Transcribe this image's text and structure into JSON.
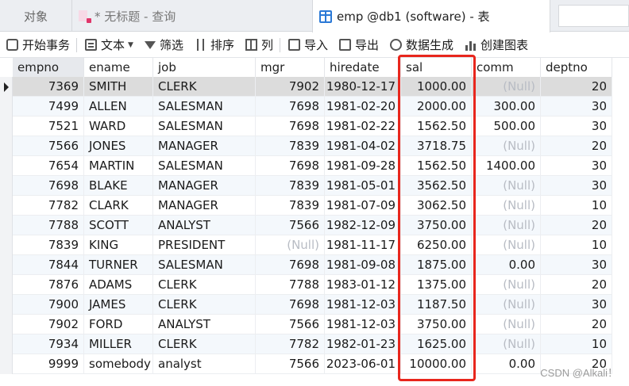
{
  "tabs": {
    "objects": "对象",
    "query": "* 无标题 - 查询",
    "table": "emp @db1 (software) - 表"
  },
  "toolbar": {
    "begin_transaction": "开始事务",
    "text": "文本",
    "filter": "筛选",
    "sort": "排序",
    "columns": "列",
    "import": "导入",
    "export": "导出",
    "data_generation": "数据生成",
    "create_chart": "创建图表"
  },
  "grid": {
    "columns": [
      "empno",
      "ename",
      "job",
      "mgr",
      "hiredate",
      "sal",
      "comm",
      "deptno"
    ],
    "rows": [
      [
        "7369",
        "SMITH",
        "CLERK",
        "7902",
        "1980-12-17",
        "1000.00",
        "(Null)",
        "20"
      ],
      [
        "7499",
        "ALLEN",
        "SALESMAN",
        "7698",
        "1981-02-20",
        "2000.00",
        "300.00",
        "30"
      ],
      [
        "7521",
        "WARD",
        "SALESMAN",
        "7698",
        "1981-02-22",
        "1562.50",
        "500.00",
        "30"
      ],
      [
        "7566",
        "JONES",
        "MANAGER",
        "7839",
        "1981-04-02",
        "3718.75",
        "(Null)",
        "20"
      ],
      [
        "7654",
        "MARTIN",
        "SALESMAN",
        "7698",
        "1981-09-28",
        "1562.50",
        "1400.00",
        "30"
      ],
      [
        "7698",
        "BLAKE",
        "MANAGER",
        "7839",
        "1981-05-01",
        "3562.50",
        "(Null)",
        "30"
      ],
      [
        "7782",
        "CLARK",
        "MANAGER",
        "7839",
        "1981-07-09",
        "3062.50",
        "(Null)",
        "10"
      ],
      [
        "7788",
        "SCOTT",
        "ANALYST",
        "7566",
        "1982-12-09",
        "3750.00",
        "(Null)",
        "20"
      ],
      [
        "7839",
        "KING",
        "PRESIDENT",
        "(Null)",
        "1981-11-17",
        "6250.00",
        "(Null)",
        "10"
      ],
      [
        "7844",
        "TURNER",
        "SALESMAN",
        "7698",
        "1981-09-08",
        "1875.00",
        "0.00",
        "30"
      ],
      [
        "7876",
        "ADAMS",
        "CLERK",
        "7788",
        "1983-01-12",
        "1375.00",
        "(Null)",
        "20"
      ],
      [
        "7900",
        "JAMES",
        "CLERK",
        "7698",
        "1981-12-03",
        "1187.50",
        "(Null)",
        "30"
      ],
      [
        "7902",
        "FORD",
        "ANALYST",
        "7566",
        "1981-12-03",
        "3750.00",
        "(Null)",
        "20"
      ],
      [
        "7934",
        "MILLER",
        "CLERK",
        "7782",
        "1982-01-23",
        "1625.00",
        "(Null)",
        "10"
      ],
      [
        "9999",
        "somebody",
        "analyst",
        "7566",
        "2023-06-01",
        "10000.00",
        "0.00",
        "20"
      ]
    ],
    "selected_row": 0
  },
  "watermark": "CSDN @Alkali！",
  "colors": {
    "highlight_border": "#e8261d",
    "null_text": "#b8bcc4",
    "selected_row": "#dcdcdc",
    "accent_blue": "#2b79d6"
  }
}
